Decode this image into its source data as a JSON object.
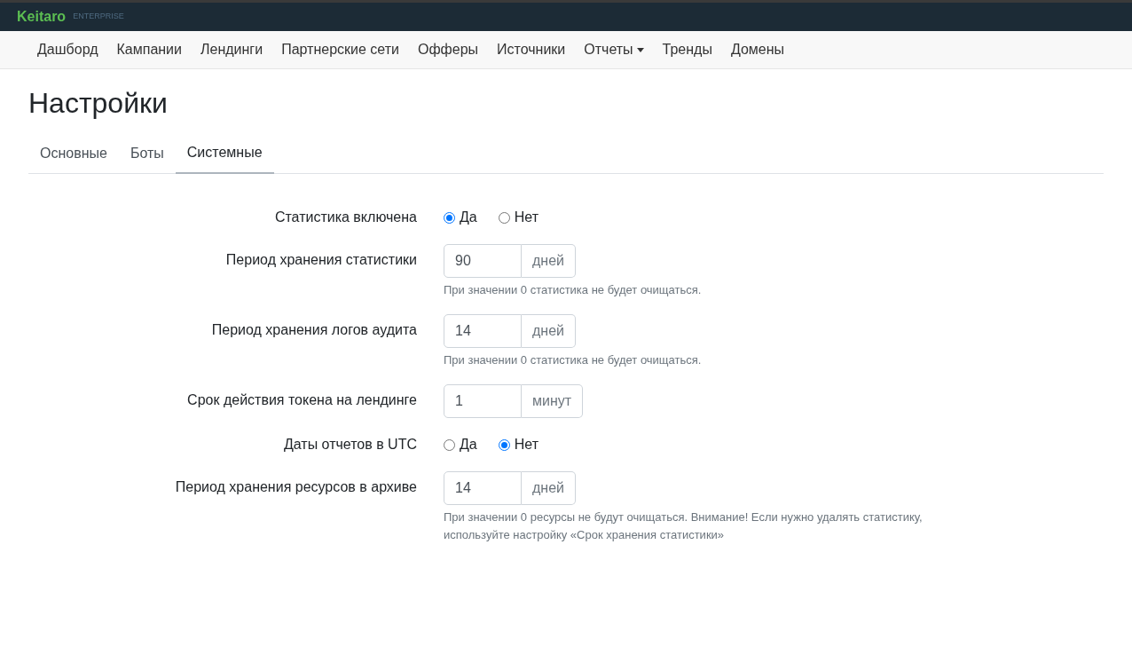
{
  "brand": {
    "name": "Keitaro",
    "edition": "ENTERPRISE"
  },
  "nav": [
    {
      "label": "Дашборд",
      "dropdown": false
    },
    {
      "label": "Кампании",
      "dropdown": false
    },
    {
      "label": "Лендинги",
      "dropdown": false
    },
    {
      "label": "Партнерские сети",
      "dropdown": false
    },
    {
      "label": "Офферы",
      "dropdown": false
    },
    {
      "label": "Источники",
      "dropdown": false
    },
    {
      "label": "Отчеты",
      "dropdown": true
    },
    {
      "label": "Тренды",
      "dropdown": false
    },
    {
      "label": "Домены",
      "dropdown": false
    }
  ],
  "page_title": "Настройки",
  "tabs": [
    {
      "label": "Основные",
      "selected": false
    },
    {
      "label": "Боты",
      "selected": false
    },
    {
      "label": "Системные",
      "selected": true
    }
  ],
  "fields": [
    {
      "kind": "radio",
      "label": "Статистика включена",
      "options": [
        {
          "label": "Да",
          "selected": true
        },
        {
          "label": "Нет",
          "selected": false
        }
      ]
    },
    {
      "kind": "input",
      "label": "Период хранения статистики",
      "value": "90",
      "unit": "дней",
      "hint": "При значении 0 статистика не будет очищаться."
    },
    {
      "kind": "input",
      "label": "Период хранения логов аудита",
      "value": "14",
      "unit": "дней",
      "hint": "При значении 0 статистика не будет очищаться."
    },
    {
      "kind": "input",
      "label": "Срок действия токена на лендинге",
      "value": "1",
      "unit": "минут"
    },
    {
      "kind": "radio",
      "label": "Даты отчетов в UTC",
      "options": [
        {
          "label": "Да",
          "selected": false
        },
        {
          "label": "Нет",
          "selected": true
        }
      ]
    },
    {
      "kind": "input",
      "label": "Период хранения ресурсов в архиве",
      "value": "14",
      "unit": "дней",
      "hint": "При значении 0 ресурсы не будут очищаться. Внимание! Если нужно удалять статистику, используйте настройку «Срок хранения статистики»"
    }
  ]
}
